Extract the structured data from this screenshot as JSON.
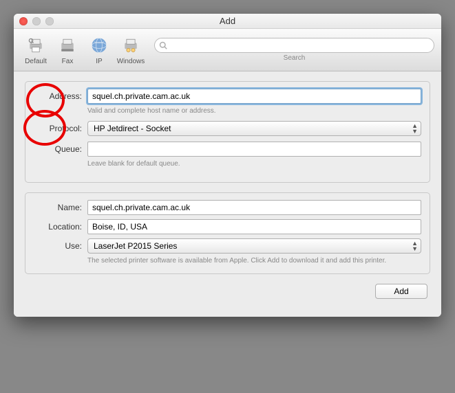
{
  "window": {
    "title": "Add"
  },
  "toolbar": {
    "items": [
      {
        "label": "Default"
      },
      {
        "label": "Fax"
      },
      {
        "label": "IP"
      },
      {
        "label": "Windows"
      }
    ],
    "search_placeholder": "",
    "search_label": "Search"
  },
  "section1": {
    "address_label": "Address:",
    "address_value": "squel.ch.private.cam.ac.uk",
    "address_hint": "Valid and complete host name or address.",
    "protocol_label": "Protocol:",
    "protocol_value": "HP Jetdirect - Socket",
    "queue_label": "Queue:",
    "queue_value": "",
    "queue_hint": "Leave blank for default queue."
  },
  "section2": {
    "name_label": "Name:",
    "name_value": "squel.ch.private.cam.ac.uk",
    "location_label": "Location:",
    "location_value": "Boise, ID, USA",
    "use_label": "Use:",
    "use_value": "LaserJet P2015 Series",
    "use_hint": "The selected printer software is available from Apple. Click Add to download it and add this printer."
  },
  "buttons": {
    "add": "Add"
  }
}
